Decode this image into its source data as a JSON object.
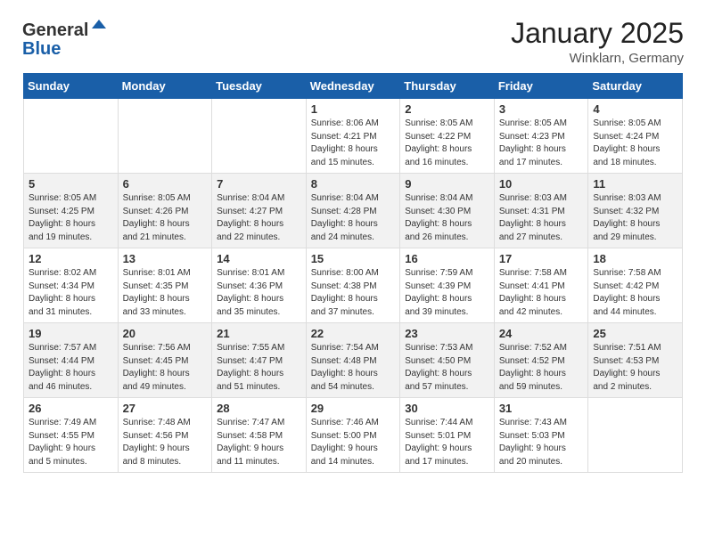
{
  "header": {
    "logo_general": "General",
    "logo_blue": "Blue",
    "month_title": "January 2025",
    "location": "Winklarn, Germany"
  },
  "weekdays": [
    "Sunday",
    "Monday",
    "Tuesday",
    "Wednesday",
    "Thursday",
    "Friday",
    "Saturday"
  ],
  "weeks": [
    [
      {
        "day": "",
        "info": ""
      },
      {
        "day": "",
        "info": ""
      },
      {
        "day": "",
        "info": ""
      },
      {
        "day": "1",
        "info": "Sunrise: 8:06 AM\nSunset: 4:21 PM\nDaylight: 8 hours\nand 15 minutes."
      },
      {
        "day": "2",
        "info": "Sunrise: 8:05 AM\nSunset: 4:22 PM\nDaylight: 8 hours\nand 16 minutes."
      },
      {
        "day": "3",
        "info": "Sunrise: 8:05 AM\nSunset: 4:23 PM\nDaylight: 8 hours\nand 17 minutes."
      },
      {
        "day": "4",
        "info": "Sunrise: 8:05 AM\nSunset: 4:24 PM\nDaylight: 8 hours\nand 18 minutes."
      }
    ],
    [
      {
        "day": "5",
        "info": "Sunrise: 8:05 AM\nSunset: 4:25 PM\nDaylight: 8 hours\nand 19 minutes."
      },
      {
        "day": "6",
        "info": "Sunrise: 8:05 AM\nSunset: 4:26 PM\nDaylight: 8 hours\nand 21 minutes."
      },
      {
        "day": "7",
        "info": "Sunrise: 8:04 AM\nSunset: 4:27 PM\nDaylight: 8 hours\nand 22 minutes."
      },
      {
        "day": "8",
        "info": "Sunrise: 8:04 AM\nSunset: 4:28 PM\nDaylight: 8 hours\nand 24 minutes."
      },
      {
        "day": "9",
        "info": "Sunrise: 8:04 AM\nSunset: 4:30 PM\nDaylight: 8 hours\nand 26 minutes."
      },
      {
        "day": "10",
        "info": "Sunrise: 8:03 AM\nSunset: 4:31 PM\nDaylight: 8 hours\nand 27 minutes."
      },
      {
        "day": "11",
        "info": "Sunrise: 8:03 AM\nSunset: 4:32 PM\nDaylight: 8 hours\nand 29 minutes."
      }
    ],
    [
      {
        "day": "12",
        "info": "Sunrise: 8:02 AM\nSunset: 4:34 PM\nDaylight: 8 hours\nand 31 minutes."
      },
      {
        "day": "13",
        "info": "Sunrise: 8:01 AM\nSunset: 4:35 PM\nDaylight: 8 hours\nand 33 minutes."
      },
      {
        "day": "14",
        "info": "Sunrise: 8:01 AM\nSunset: 4:36 PM\nDaylight: 8 hours\nand 35 minutes."
      },
      {
        "day": "15",
        "info": "Sunrise: 8:00 AM\nSunset: 4:38 PM\nDaylight: 8 hours\nand 37 minutes."
      },
      {
        "day": "16",
        "info": "Sunrise: 7:59 AM\nSunset: 4:39 PM\nDaylight: 8 hours\nand 39 minutes."
      },
      {
        "day": "17",
        "info": "Sunrise: 7:58 AM\nSunset: 4:41 PM\nDaylight: 8 hours\nand 42 minutes."
      },
      {
        "day": "18",
        "info": "Sunrise: 7:58 AM\nSunset: 4:42 PM\nDaylight: 8 hours\nand 44 minutes."
      }
    ],
    [
      {
        "day": "19",
        "info": "Sunrise: 7:57 AM\nSunset: 4:44 PM\nDaylight: 8 hours\nand 46 minutes."
      },
      {
        "day": "20",
        "info": "Sunrise: 7:56 AM\nSunset: 4:45 PM\nDaylight: 8 hours\nand 49 minutes."
      },
      {
        "day": "21",
        "info": "Sunrise: 7:55 AM\nSunset: 4:47 PM\nDaylight: 8 hours\nand 51 minutes."
      },
      {
        "day": "22",
        "info": "Sunrise: 7:54 AM\nSunset: 4:48 PM\nDaylight: 8 hours\nand 54 minutes."
      },
      {
        "day": "23",
        "info": "Sunrise: 7:53 AM\nSunset: 4:50 PM\nDaylight: 8 hours\nand 57 minutes."
      },
      {
        "day": "24",
        "info": "Sunrise: 7:52 AM\nSunset: 4:52 PM\nDaylight: 8 hours\nand 59 minutes."
      },
      {
        "day": "25",
        "info": "Sunrise: 7:51 AM\nSunset: 4:53 PM\nDaylight: 9 hours\nand 2 minutes."
      }
    ],
    [
      {
        "day": "26",
        "info": "Sunrise: 7:49 AM\nSunset: 4:55 PM\nDaylight: 9 hours\nand 5 minutes."
      },
      {
        "day": "27",
        "info": "Sunrise: 7:48 AM\nSunset: 4:56 PM\nDaylight: 9 hours\nand 8 minutes."
      },
      {
        "day": "28",
        "info": "Sunrise: 7:47 AM\nSunset: 4:58 PM\nDaylight: 9 hours\nand 11 minutes."
      },
      {
        "day": "29",
        "info": "Sunrise: 7:46 AM\nSunset: 5:00 PM\nDaylight: 9 hours\nand 14 minutes."
      },
      {
        "day": "30",
        "info": "Sunrise: 7:44 AM\nSunset: 5:01 PM\nDaylight: 9 hours\nand 17 minutes."
      },
      {
        "day": "31",
        "info": "Sunrise: 7:43 AM\nSunset: 5:03 PM\nDaylight: 9 hours\nand 20 minutes."
      },
      {
        "day": "",
        "info": ""
      }
    ]
  ]
}
